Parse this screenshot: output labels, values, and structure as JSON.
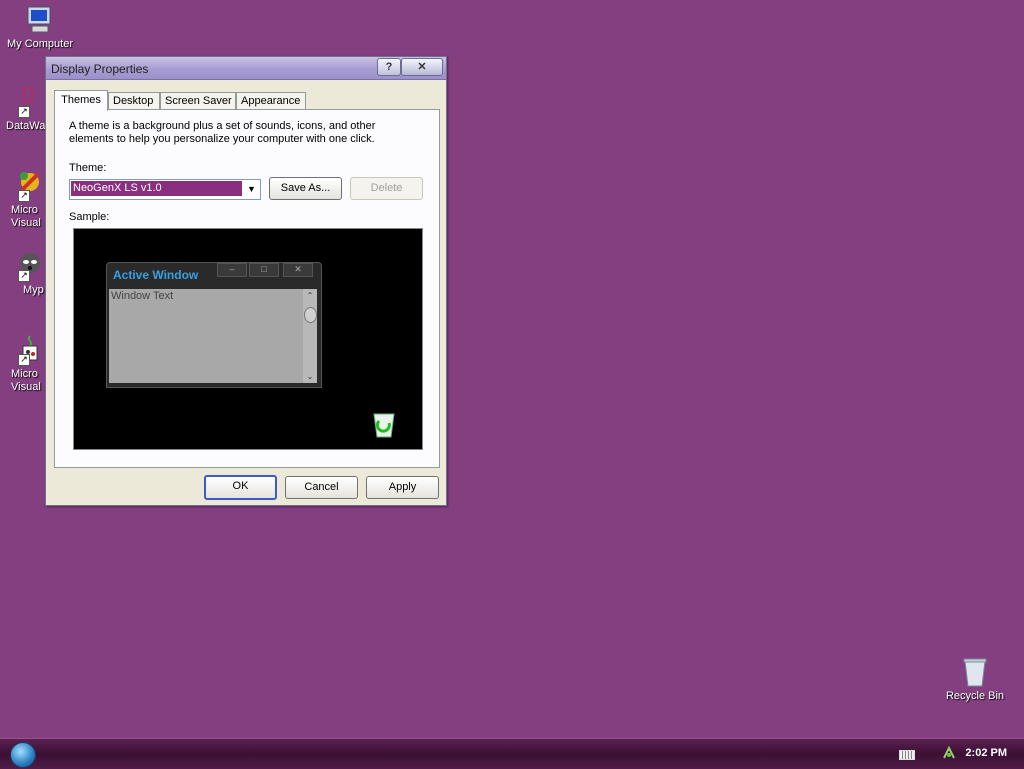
{
  "desktop": {
    "icons": [
      {
        "label": "My Computer"
      },
      {
        "label": "DataWa"
      },
      {
        "label": "Micro\nVisual"
      },
      {
        "label": "Myp"
      },
      {
        "label": "Micro\nVisual"
      },
      {
        "label": "Recycle Bin"
      }
    ]
  },
  "dialog": {
    "title": "Display Properties",
    "help_button": "?",
    "close_button": "✕",
    "tabs": [
      {
        "label": "Themes"
      },
      {
        "label": "Desktop"
      },
      {
        "label": "Screen Saver"
      },
      {
        "label": "Appearance"
      }
    ],
    "description": "A theme is a background plus a set of sounds, icons, and other elements to help you personalize your computer with one click.",
    "theme_label": "Theme:",
    "theme_value": "NeoGenX LS v1.0",
    "save_as_label": "Save As...",
    "delete_label": "Delete",
    "sample_label": "Sample:",
    "sample": {
      "active_window_title": "Active Window",
      "window_text": "Window Text"
    },
    "ok_label": "OK",
    "cancel_label": "Cancel",
    "apply_label": "Apply"
  },
  "taskbar": {
    "clock": "2:02 PM"
  }
}
